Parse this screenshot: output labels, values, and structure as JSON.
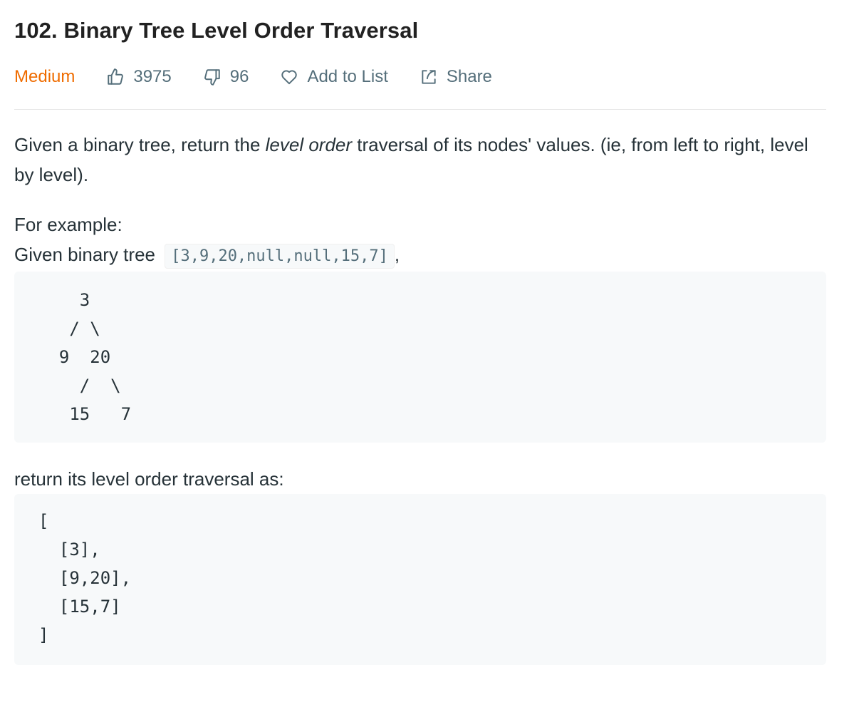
{
  "problem": {
    "title": "102. Binary Tree Level Order Traversal",
    "difficulty": "Medium",
    "likes": "3975",
    "dislikes": "96",
    "add_to_list_label": "Add to List",
    "share_label": "Share"
  },
  "description": {
    "part1": "Given a binary tree, return the ",
    "emphasis": "level order",
    "part2": " traversal of its nodes' values. (ie, from left to right, level by level).",
    "example_intro": "For example:",
    "given_text": "Given binary tree ",
    "given_code": "[3,9,20,null,null,15,7]",
    "given_suffix": ",",
    "tree_diagram": "    3\n   / \\\n  9  20\n    /  \\\n   15   7",
    "return_text": "return its level order traversal as:",
    "result_code": "[\n  [3],\n  [9,20],\n  [15,7]\n]"
  },
  "colors": {
    "difficulty_medium": "#ef6c00",
    "meta_text": "#546e7a",
    "code_bg": "#f7f9fa"
  },
  "icons": [
    "thumbs-up-icon",
    "thumbs-down-icon",
    "heart-icon",
    "share-icon"
  ]
}
